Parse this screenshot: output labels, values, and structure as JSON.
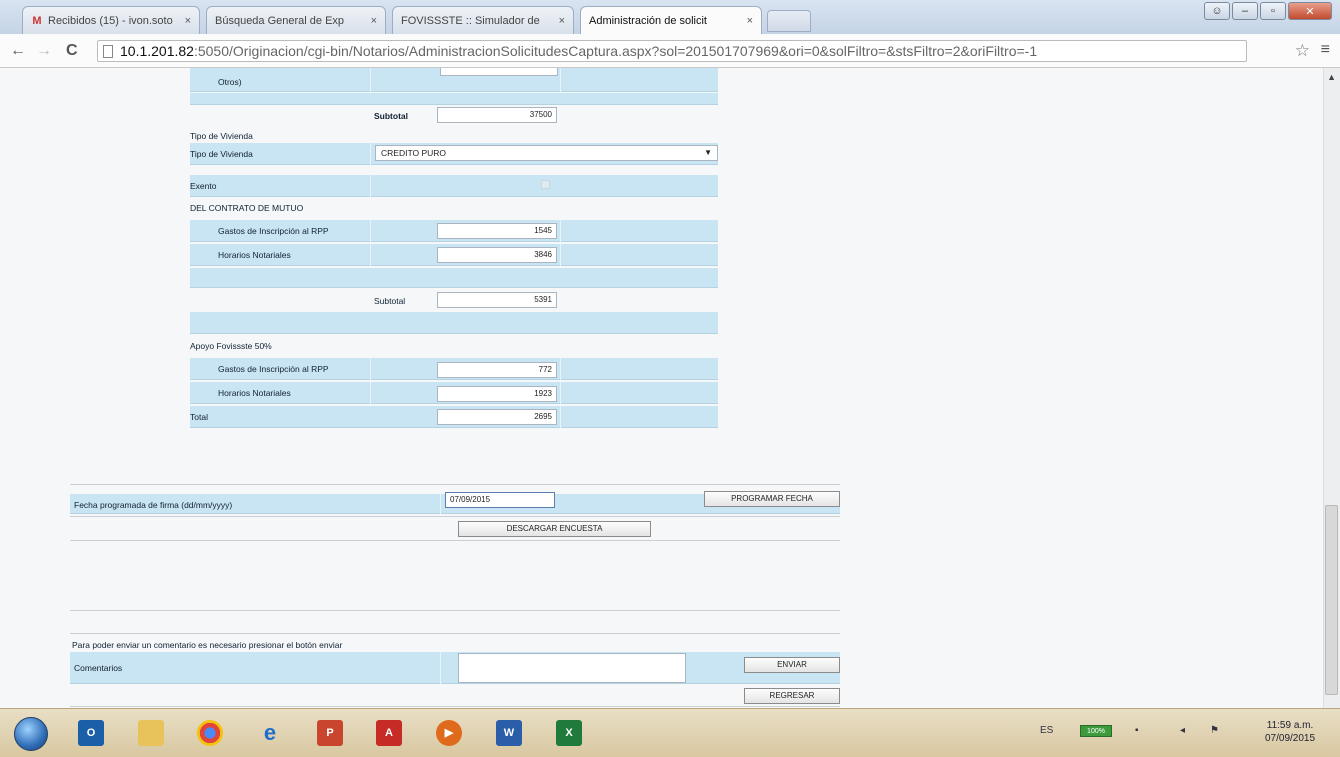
{
  "browser": {
    "tabs": [
      {
        "title": "Recibidos (15) - ivon.soto",
        "icon": "gmail-icon"
      },
      {
        "title": "Búsqueda General de Exp",
        "icon": "page-icon"
      },
      {
        "title": "FOVISSSTE :: Simulador de",
        "icon": "page-icon"
      },
      {
        "title": "Administración de solicit",
        "icon": "page-icon"
      }
    ],
    "url_host": "10.1.201.82",
    "url_rest": ":5050/Originacion/cgi-bin/Notarios/AdministracionSolicitudesCaptura.aspx?sol=201501707969&ori=0&solFiltro=&stsFiltro=2&oriFiltro=-1"
  },
  "form": {
    "otros_label": "Otros)",
    "subtotal1_label": "Subtotal",
    "subtotal1_value": "37500",
    "tipo_vivienda_heading": "Tipo de Vivienda",
    "tipo_vivienda_label": "Tipo de Vivienda",
    "tipo_vivienda_value": "CREDITO PURO",
    "exento_label": "Exento",
    "contrato_heading": "DEL CONTRATO DE MUTUO",
    "gastos_label": "Gastos de Inscripción al RPP",
    "gastos_value": "1545",
    "honorarios_label": "Horarios Notariales",
    "honorarios_value": "3846",
    "subtotal2_label": "Subtotal",
    "subtotal2_value": "5391",
    "apoyo_heading": "Apoyo Fovissste 50%",
    "apoyo_gastos_label": "Gastos de Inscripción al RPP",
    "apoyo_gastos_value": "772",
    "apoyo_honorarios_label": "Horarios Notariales",
    "apoyo_honorarios_value": "1923",
    "total_label": "Total",
    "total_value": "2695",
    "fecha_label": "Fecha programada de firma (dd/mm/yyyy)",
    "fecha_value": "07/09/2015",
    "programar_button": "PROGRAMAR FECHA",
    "descargar_button": "DESCARGAR ENCUESTA",
    "comentario_note": "Para poder enviar un comentario es necesario presionar el botón enviar",
    "comentarios_label": "Comentarios",
    "enviar_button": "ENVIAR",
    "regresar_button": "REGRESAR"
  },
  "taskbar": {
    "language": "ES",
    "battery": "100%",
    "time": "11:59 a.m.",
    "date": "07/09/2015"
  }
}
